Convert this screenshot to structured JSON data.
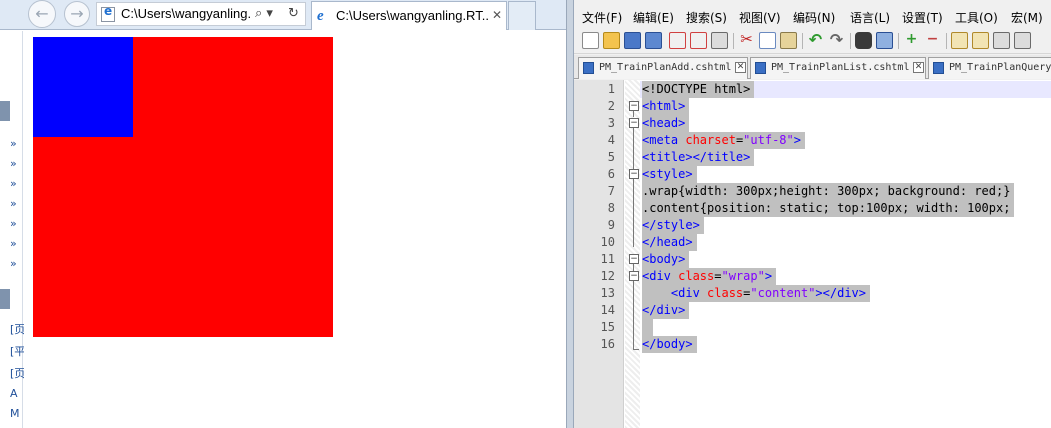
{
  "browser": {
    "address": "C:\\Users\\wangyanling.",
    "search_glyph": "⌕ ▾",
    "refresh_glyph": "↻",
    "close_glyph": "✕",
    "tab_title": "C:\\Users\\wangyanling.RT...",
    "tab_close": "✕",
    "favorites_links": [
      "»",
      "»",
      "»",
      "»",
      "»",
      "»",
      "»",
      "[页",
      "[平",
      "[页",
      "A",
      "M"
    ],
    "rendered": {
      "wrap_color": "#ff0000",
      "content_color": "#0000ff"
    }
  },
  "notepad": {
    "menu": [
      "文件(F)",
      "编辑(E)",
      "搜索(S)",
      "视图(V)",
      "编码(N)",
      "语言(L)",
      "设置(T)",
      "工具(O)",
      "宏(M)"
    ],
    "tabs": [
      {
        "label": "PM_TrainPlanAdd.cshtml",
        "close": "✕"
      },
      {
        "label": "PM_TrainPlanList.cshtml",
        "close": "✕"
      },
      {
        "label": "PM_TrainPlanQuery"
      }
    ],
    "line_numbers": [
      "1",
      "2",
      "3",
      "4",
      "5",
      "6",
      "7",
      "8",
      "9",
      "10",
      "11",
      "12",
      "13",
      "14",
      "15",
      "16"
    ],
    "fold_glyph": "−",
    "code": {
      "l1": "<!DOCTYPE html>",
      "l2": "<html>",
      "l3": "<head>",
      "l4_open": "<meta ",
      "l4_attr": "charset",
      "l4_eq": "=",
      "l4_val": "\"utf-8\"",
      "l4_close": ">",
      "l5": "<title></title>",
      "l6": "<style>",
      "l7": ".wrap{width: 300px;height: 300px; background: red;}",
      "l8": ".content{position: static; top:100px; width: 100px;",
      "l9": "</style>",
      "l10": "</head>",
      "l11": "<body>",
      "l12_open": "<div ",
      "l12_attr": "class",
      "l12_eq": "=",
      "l12_val": "\"wrap\"",
      "l12_close": ">",
      "l13_indent": "    ",
      "l13_open": "<div ",
      "l13_attr": "class",
      "l13_eq": "=",
      "l13_val": "\"content\"",
      "l13_close": "></div>",
      "l14": "</div>",
      "l15": " ",
      "l16": "</body>"
    }
  }
}
